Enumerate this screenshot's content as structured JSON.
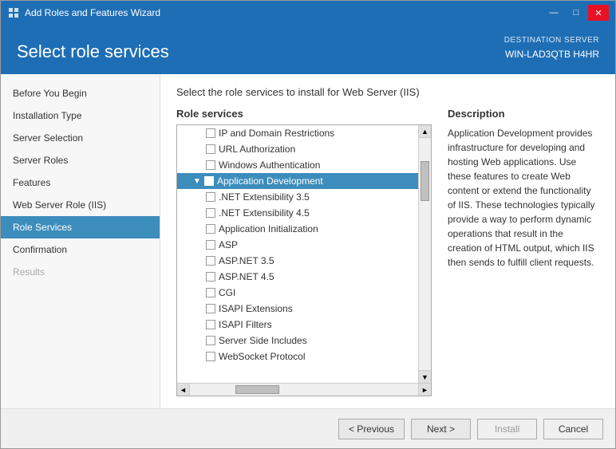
{
  "window": {
    "title": "Add Roles and Features Wizard",
    "icon": "⚙"
  },
  "titlebar_controls": {
    "minimize": "—",
    "maximize": "□",
    "close": "✕"
  },
  "header": {
    "title": "Select role services",
    "server_label": "DESTINATION SERVER",
    "server_name": "WIN-LAD3QTB H4HR"
  },
  "instruction": "Select the role services to install for Web Server (IIS)",
  "sidebar": {
    "items": [
      {
        "label": "Before You Begin",
        "state": "normal"
      },
      {
        "label": "Installation Type",
        "state": "normal"
      },
      {
        "label": "Server Selection",
        "state": "normal"
      },
      {
        "label": "Server Roles",
        "state": "normal"
      },
      {
        "label": "Features",
        "state": "normal"
      },
      {
        "label": "Web Server Role (IIS)",
        "state": "normal"
      },
      {
        "label": "Role Services",
        "state": "active"
      },
      {
        "label": "Confirmation",
        "state": "normal"
      },
      {
        "label": "Results",
        "state": "disabled"
      }
    ]
  },
  "role_services": {
    "panel_title": "Role services",
    "items": [
      {
        "label": "IP and Domain Restrictions",
        "indent": 2,
        "checked": false,
        "selected": false
      },
      {
        "label": "URL Authorization",
        "indent": 2,
        "checked": false,
        "selected": false
      },
      {
        "label": "Windows Authentication",
        "indent": 2,
        "checked": false,
        "selected": false
      },
      {
        "label": "Application Development",
        "indent": 1,
        "checked": false,
        "selected": true,
        "expandable": true,
        "expanded": true
      },
      {
        "label": ".NET Extensibility 3.5",
        "indent": 2,
        "checked": false,
        "selected": false
      },
      {
        "label": ".NET Extensibility 4.5",
        "indent": 2,
        "checked": false,
        "selected": false
      },
      {
        "label": "Application Initialization",
        "indent": 2,
        "checked": false,
        "selected": false
      },
      {
        "label": "ASP",
        "indent": 2,
        "checked": false,
        "selected": false
      },
      {
        "label": "ASP.NET 3.5",
        "indent": 2,
        "checked": false,
        "selected": false
      },
      {
        "label": "ASP.NET 4.5",
        "indent": 2,
        "checked": false,
        "selected": false
      },
      {
        "label": "CGI",
        "indent": 2,
        "checked": false,
        "selected": false
      },
      {
        "label": "ISAPI Extensions",
        "indent": 2,
        "checked": false,
        "selected": false
      },
      {
        "label": "ISAPI Filters",
        "indent": 2,
        "checked": false,
        "selected": false
      },
      {
        "label": "Server Side Includes",
        "indent": 2,
        "checked": false,
        "selected": false
      },
      {
        "label": "WebSocket Protocol",
        "indent": 2,
        "checked": false,
        "selected": false
      }
    ]
  },
  "description": {
    "title": "Description",
    "text": "Application Development provides infrastructure for developing and hosting Web applications. Use these features to create Web content or extend the functionality of IIS. These technologies typically provide a way to perform dynamic operations that result in the creation of HTML output, which IIS then sends to fulfill client requests."
  },
  "footer": {
    "previous_label": "< Previous",
    "next_label": "Next >",
    "install_label": "Install",
    "cancel_label": "Cancel"
  }
}
